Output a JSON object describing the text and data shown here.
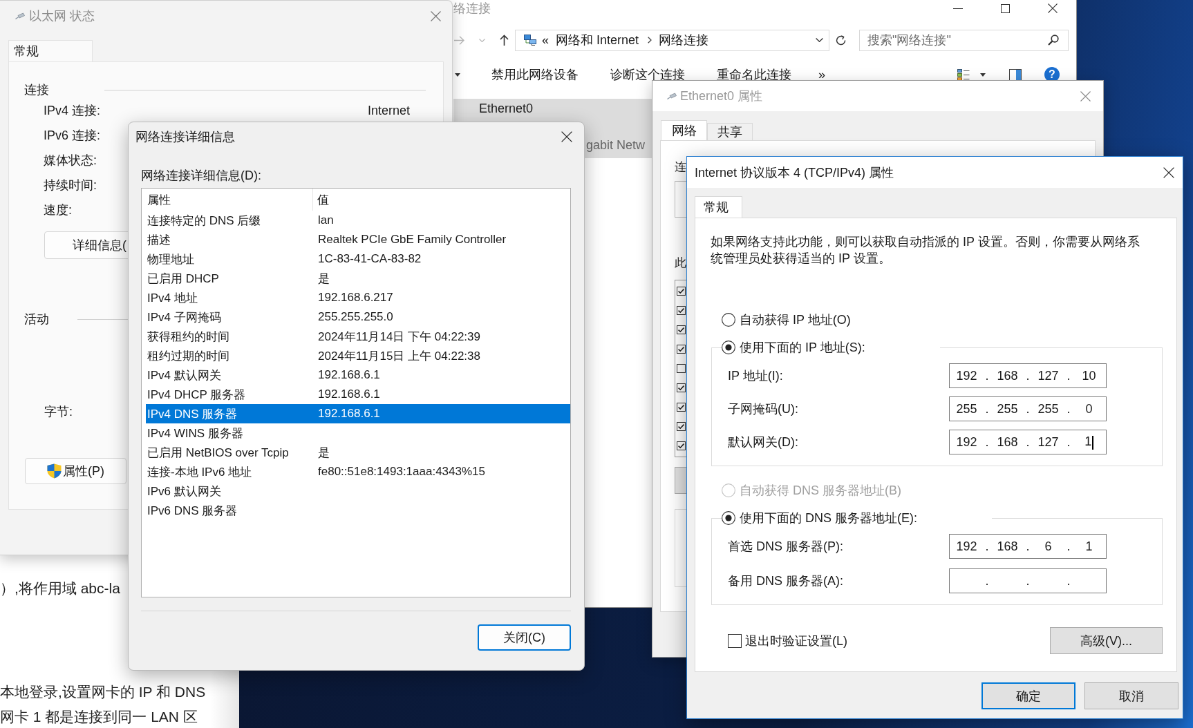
{
  "document": {
    "lines": [
      "）,将作用域 abc-la",
      "本地登录,设置网卡的 IP 和 DNS",
      "网卡 1 都是连接到同一 LAN 区"
    ]
  },
  "explorer": {
    "title": "络连接",
    "address": {
      "overflow": "«",
      "crumbs": [
        "网络和 Internet",
        "网络连接"
      ]
    },
    "search": {
      "placeholder": "搜索\"网络连接\""
    },
    "commands": [
      "禁用此网络设备",
      "诊断这个连接",
      "重命名此连接"
    ],
    "more": "»",
    "help": "?",
    "items": [
      {
        "name": "Ethernet0",
        "detail": "gabit Netw",
        "selected": true
      }
    ]
  },
  "status_window": {
    "title": "以太网 状态",
    "tabs": [
      {
        "label": "常规",
        "selected": true
      }
    ],
    "connection": {
      "heading": "连接",
      "rows": [
        {
          "label": "IPv4 连接:",
          "value": "Internet"
        },
        {
          "label": "IPv6 连接:"
        },
        {
          "label": "媒体状态:"
        },
        {
          "label": "持续时间:"
        },
        {
          "label": "速度:"
        }
      ],
      "details_button": "详细信息("
    },
    "activity": {
      "heading": "活动",
      "bytes_label": "字节:"
    },
    "properties_button": "属性(P)"
  },
  "details_dialog": {
    "title": "网络连接详细信息",
    "list_label": "网络连接详细信息(D):",
    "columns": [
      "属性",
      "值"
    ],
    "rows": [
      {
        "property": "连接特定的 DNS 后缀",
        "value": "lan",
        "selected": false
      },
      {
        "property": "描述",
        "value": "Realtek PCIe GbE Family Controller",
        "selected": false
      },
      {
        "property": "物理地址",
        "value": "1C-83-41-CA-83-82",
        "selected": false
      },
      {
        "property": "已启用 DHCP",
        "value": "是",
        "selected": false
      },
      {
        "property": "IPv4 地址",
        "value": "192.168.6.217",
        "selected": false
      },
      {
        "property": "IPv4 子网掩码",
        "value": "255.255.255.0",
        "selected": false
      },
      {
        "property": "获得租约的时间",
        "value": "2024年11月14日 下午 04:22:39",
        "selected": false
      },
      {
        "property": "租约过期的时间",
        "value": "2024年11月15日 上午 04:22:38",
        "selected": false
      },
      {
        "property": "IPv4 默认网关",
        "value": "192.168.6.1",
        "selected": false
      },
      {
        "property": "IPv4 DHCP 服务器",
        "value": "192.168.6.1",
        "selected": false
      },
      {
        "property": "IPv4 DNS 服务器",
        "value": "192.168.6.1",
        "selected": true
      },
      {
        "property": "IPv4 WINS 服务器",
        "selected": false
      },
      {
        "property": "已启用 NetBIOS over Tcpip",
        "value": "是",
        "selected": false
      },
      {
        "property": "连接-本地 IPv6 地址",
        "value": "fe80::51e8:1493:1aaa:4343%15",
        "selected": false
      },
      {
        "property": "IPv6 默认网关",
        "selected": false
      },
      {
        "property": "IPv6 DNS 服务器",
        "selected": false
      }
    ],
    "close_button": {
      "label": "关闭(C)",
      "default": true
    }
  },
  "ethernet0_window": {
    "title": "Ethernet0 属性",
    "tabs": [
      {
        "label": "网络",
        "selected": true
      },
      {
        "label": "共享",
        "selected": false
      }
    ],
    "connect_using_label": "连",
    "components_label": "此",
    "components": [
      {
        "checked": true
      },
      {
        "checked": true
      },
      {
        "checked": true
      },
      {
        "checked": true
      },
      {
        "checked": false
      },
      {
        "checked": true
      },
      {
        "checked": true
      },
      {
        "checked": true
      },
      {
        "checked": true
      }
    ]
  },
  "ipv4_window": {
    "title": "Internet 协议版本 4 (TCP/IPv4) 属性",
    "tabs": [
      {
        "label": "常规",
        "selected": true
      }
    ],
    "description": "如果网络支持此功能，则可以获取自动指派的 IP 设置。否则，你需要从网络系统管理员处获得适当的 IP 设置。",
    "ip_options": [
      {
        "label": "自动获得 IP 地址(O)",
        "selected": false,
        "disabled": false
      },
      {
        "label": "使用下面的 IP 地址(S):",
        "selected": true,
        "disabled": false
      }
    ],
    "ip_fields": [
      {
        "label": "IP 地址(I):",
        "value": "192 . 168 . 127 . 10",
        "focused": false
      },
      {
        "label": "子网掩码(U):",
        "value": "255 . 255 . 255 . 0",
        "focused": false
      },
      {
        "label": "默认网关(D):",
        "value": "192 . 168 . 127 . 1",
        "focused": true
      }
    ],
    "dns_options": [
      {
        "label": "自动获得 DNS 服务器地址(B)",
        "selected": false,
        "disabled": true
      },
      {
        "label": "使用下面的 DNS 服务器地址(E):",
        "selected": true,
        "disabled": false
      }
    ],
    "dns_fields": [
      {
        "label": "首选 DNS 服务器(P):",
        "value": "192 . 168 . 6 . 1",
        "focused": false
      },
      {
        "label": "备用 DNS 服务器(A):",
        "value": ". . .",
        "focused": false
      }
    ],
    "validate_on_exit": {
      "label": "退出时验证设置(L)",
      "checked": false
    },
    "advanced_button": "高级(V)...",
    "buttons": [
      {
        "label": "确定",
        "default": true
      },
      {
        "label": "取消",
        "default": false
      }
    ]
  }
}
